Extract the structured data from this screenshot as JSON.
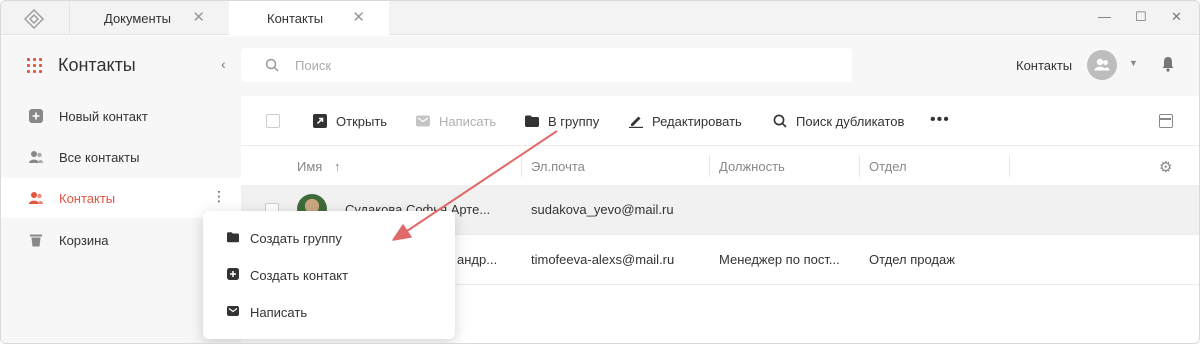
{
  "titlebar": {
    "tabs": [
      {
        "label": "Документы"
      },
      {
        "label": "Контакты"
      }
    ]
  },
  "sidebar": {
    "title": "Контакты",
    "items": [
      {
        "label": "Новый контакт"
      },
      {
        "label": "Все контакты"
      },
      {
        "label": "Контакты"
      },
      {
        "label": "Корзина"
      }
    ]
  },
  "header": {
    "search_placeholder": "Поиск",
    "section_label": "Контакты"
  },
  "toolbar": {
    "open": "Открыть",
    "write": "Написать",
    "to_group": "В группу",
    "edit": "Редактировать",
    "find_duplicates": "Поиск дубликатов",
    "more": "•••"
  },
  "table": {
    "columns": [
      "Имя",
      "Эл.почта",
      "Должность",
      "Отдел"
    ],
    "rows": [
      {
        "name": "Судакова Софья Арте...",
        "email": "sudakova_yevo@mail.ru",
        "position": "",
        "department": ""
      },
      {
        "name": "андр...",
        "email": "timofeeva-alexs@mail.ru",
        "position": "Менеджер по пост...",
        "department": "Отдел продаж"
      }
    ]
  },
  "context_menu": {
    "items": [
      {
        "label": "Создать группу"
      },
      {
        "label": "Создать контакт"
      },
      {
        "label": "Написать"
      }
    ]
  },
  "colors": {
    "accent": "#e2563f",
    "annotation_arrow": "#e06a6a"
  }
}
